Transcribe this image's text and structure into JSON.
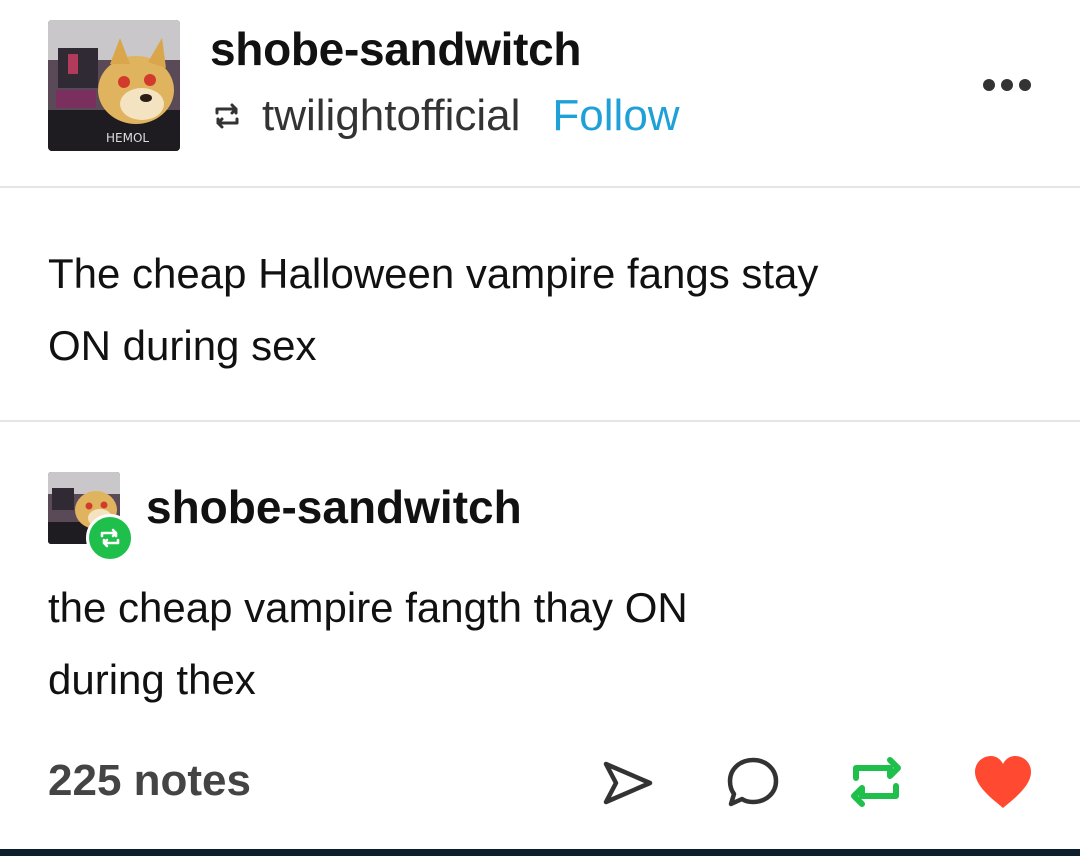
{
  "header": {
    "username": "shobe-sandwitch",
    "reblogged_from": "twilightofficial",
    "follow_label": "Follow"
  },
  "post": {
    "lines": [
      "The cheap Halloween vampire fangs stay",
      "ON during sex"
    ]
  },
  "reblog": {
    "username": "shobe-sandwitch",
    "lines": [
      "the cheap vampire fangth thay ON",
      "during thex"
    ]
  },
  "footer": {
    "notes": "225 notes"
  },
  "colors": {
    "follow": "#1fa1d8",
    "reblog_green": "#1fbf4b",
    "like_red": "#ff4930"
  },
  "icons": {
    "more": "more-horizontal-icon",
    "share": "share-arrow-icon",
    "reply": "reply-bubble-icon",
    "reblog": "reblog-icon",
    "like": "heart-icon"
  }
}
